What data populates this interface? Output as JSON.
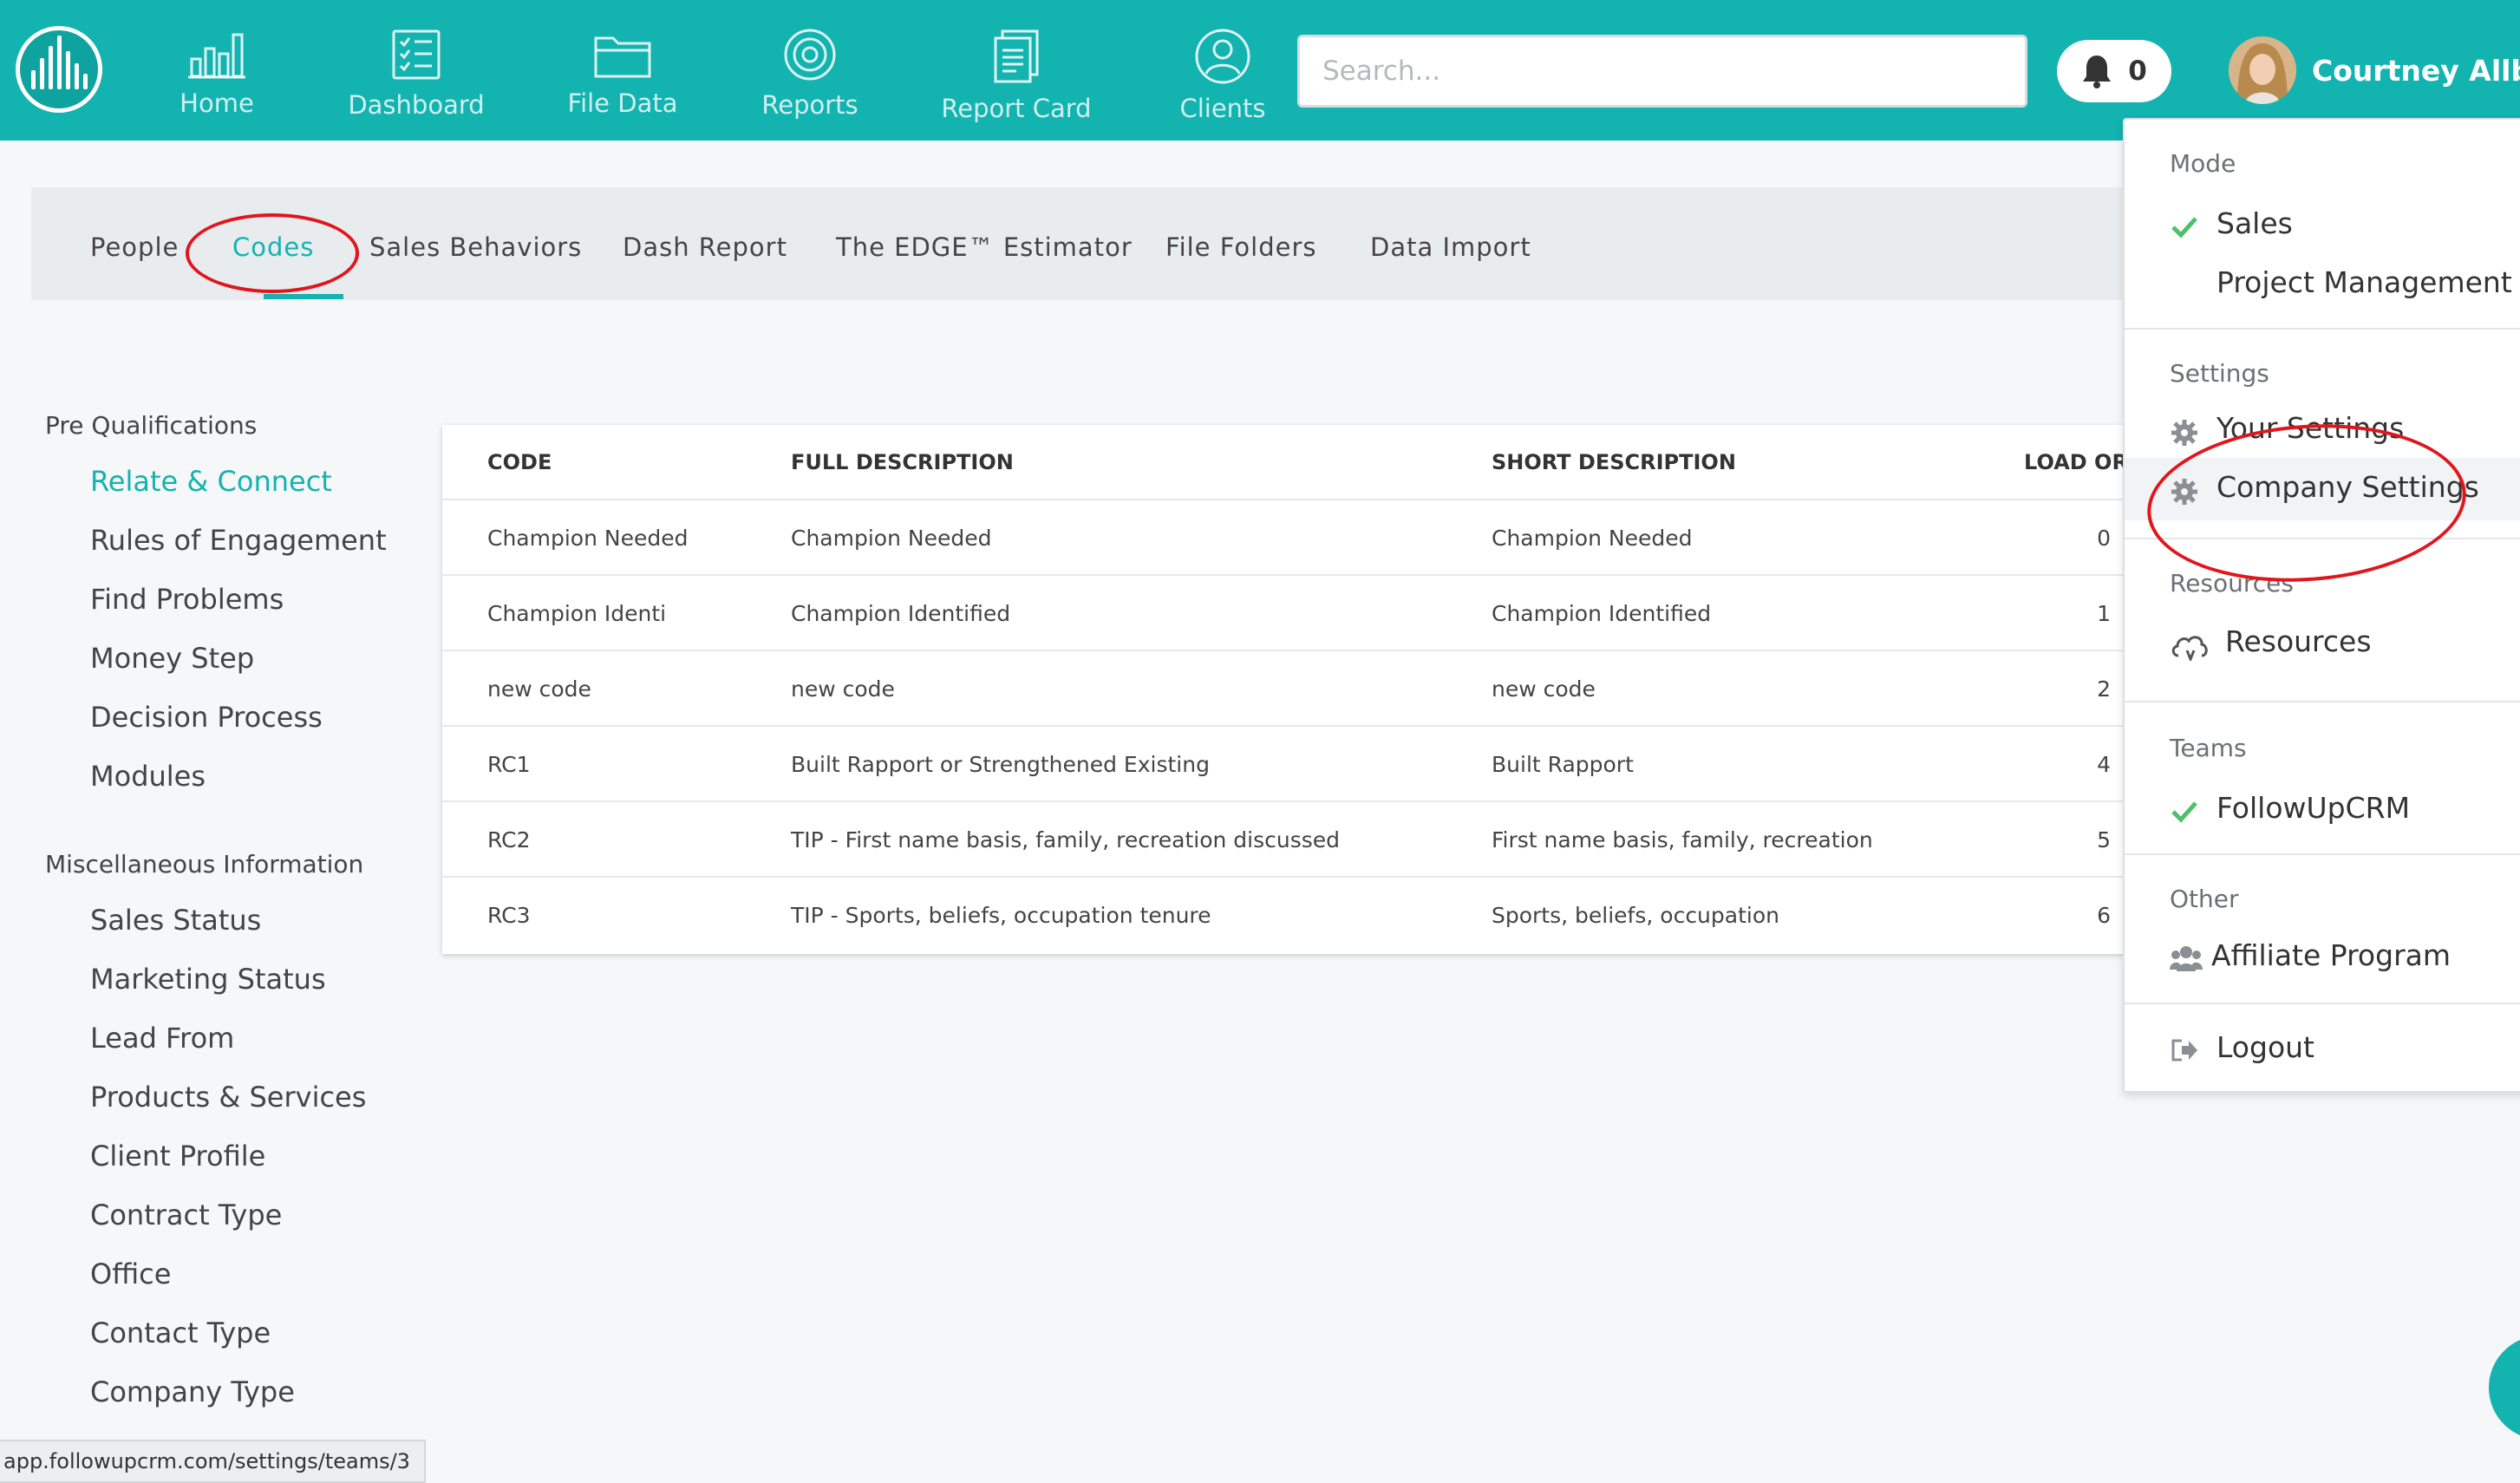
{
  "nav": {
    "items": [
      {
        "label": "Home",
        "icon": "bar-chart-icon"
      },
      {
        "label": "Dashboard",
        "icon": "checklist-icon"
      },
      {
        "label": "File Data",
        "icon": "folder-icon"
      },
      {
        "label": "Reports",
        "icon": "target-icon"
      },
      {
        "label": "Report Card",
        "icon": "document-icon"
      },
      {
        "label": "Clients",
        "icon": "user-icon"
      }
    ],
    "search_placeholder": "Search...",
    "notification_count": "0",
    "user_name": "Courtney Allbee"
  },
  "tabs": [
    "People",
    "Codes",
    "Sales Behaviors",
    "Dash Report",
    "The EDGE™ Estimator",
    "File Folders",
    "Data Import"
  ],
  "active_tab": "Codes",
  "sidebar": {
    "sections": [
      {
        "title": "Pre Qualifications",
        "items": [
          "Relate & Connect",
          "Rules of Engagement",
          "Find Problems",
          "Money Step",
          "Decision Process",
          "Modules"
        ]
      },
      {
        "title": "Miscellaneous Information",
        "items": [
          "Sales Status",
          "Marketing Status",
          "Lead From",
          "Products & Services",
          "Client Profile",
          "Contract Type",
          "Office",
          "Contact Type",
          "Company Type"
        ]
      }
    ],
    "active_item": "Relate & Connect"
  },
  "table": {
    "columns": [
      "CODE",
      "FULL DESCRIPTION",
      "SHORT DESCRIPTION",
      "LOAD ORDER"
    ],
    "rows": [
      [
        "Champion Needed",
        "Champion Needed",
        "Champion Needed",
        "0"
      ],
      [
        "Champion Identi",
        "Champion Identified",
        "Champion Identified",
        "1"
      ],
      [
        "new code",
        "new code",
        "new code",
        "2"
      ],
      [
        "RC1",
        "Built Rapport or Strengthened Existing",
        "Built Rapport",
        "4"
      ],
      [
        "RC2",
        "TIP - First name basis, family, recreation discussed",
        "First name basis, family, recreation",
        "5"
      ],
      [
        "RC3",
        "TIP - Sports, beliefs, occupation tenure",
        "Sports, beliefs, occupation",
        "6"
      ]
    ]
  },
  "dropdown": {
    "mode_title": "Mode",
    "mode_sales": "Sales",
    "mode_pm": "Project Management",
    "settings_title": "Settings",
    "your_settings": "Your Settings",
    "company_settings": "Company Settings",
    "resources_title": "Resources",
    "resources": "Resources",
    "teams_title": "Teams",
    "team_name": "FollowUpCRM",
    "other_title": "Other",
    "affiliate": "Affiliate Program",
    "logout": "Logout"
  },
  "status_url": "app.followupcrm.com/settings/teams/3",
  "colors": {
    "brand": "#13b3b0",
    "annotation": "#e0161d",
    "check": "#4fbf6a"
  }
}
